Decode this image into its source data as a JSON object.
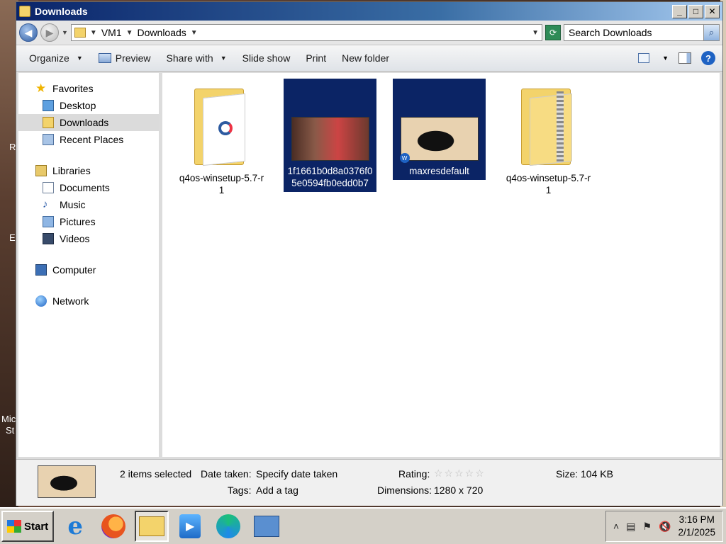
{
  "window": {
    "title": "Downloads",
    "controls": {
      "minimize": "_",
      "maximize": "□",
      "close": "✕"
    }
  },
  "address": {
    "segments": [
      "VM1",
      "Downloads"
    ],
    "search_placeholder": "Search Downloads"
  },
  "toolbar": {
    "organize": "Organize",
    "preview": "Preview",
    "share_with": "Share with",
    "slide_show": "Slide show",
    "print": "Print",
    "new_folder": "New folder"
  },
  "nav": {
    "favorites": {
      "label": "Favorites",
      "items": [
        "Desktop",
        "Downloads",
        "Recent Places"
      ]
    },
    "libraries": {
      "label": "Libraries",
      "items": [
        "Documents",
        "Music",
        "Pictures",
        "Videos"
      ]
    },
    "computer": "Computer",
    "network": "Network",
    "selected": "Downloads"
  },
  "files": [
    {
      "name": "q4os-winsetup-5.7-r1",
      "type": "folder",
      "selected": false
    },
    {
      "name": "1f1661b0d8a0376f05e0594fb0edd0b7",
      "type": "image",
      "selected": true
    },
    {
      "name": "maxresdefault",
      "type": "image",
      "selected": true
    },
    {
      "name": "q4os-winsetup-5.7-r1",
      "type": "zip",
      "selected": false
    }
  ],
  "details": {
    "selection": "2 items selected",
    "date_taken_label": "Date taken:",
    "date_taken_value": "Specify date taken",
    "tags_label": "Tags:",
    "tags_value": "Add a tag",
    "rating_label": "Rating:",
    "rating_stars": "☆☆☆☆☆",
    "dimensions_label": "Dimensions:",
    "dimensions_value": "1280 x 720",
    "size_label": "Size:",
    "size_value": "104 KB"
  },
  "taskbar": {
    "start": "Start",
    "clock_time": "3:16 PM",
    "clock_date": "2/1/2025"
  },
  "desktop_fragments": [
    "R",
    "E",
    "Mic",
    "St"
  ]
}
